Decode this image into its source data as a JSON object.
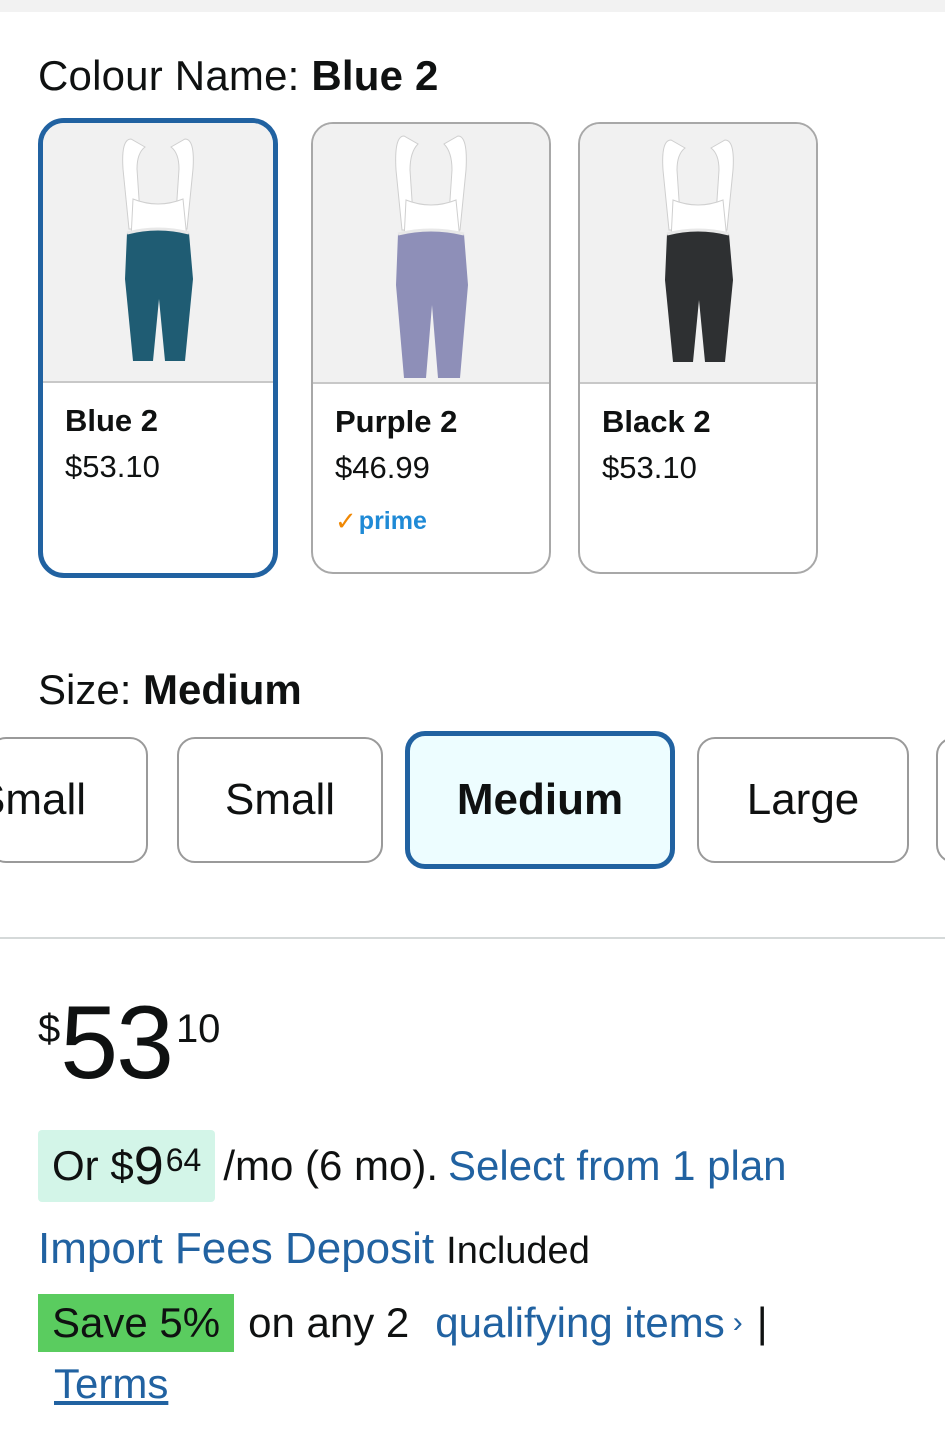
{
  "colour": {
    "label": "Colour Name: ",
    "value": "Blue 2",
    "swatches": [
      {
        "name": "Blue 2",
        "price": "$53.10",
        "color": "#1f5c73",
        "prime": ""
      },
      {
        "name": "Purple 2",
        "price": "$46.99",
        "color": "#8e8fb8",
        "prime": "prime"
      },
      {
        "name": "Black 2",
        "price": "$53.10",
        "color": "#2e3032",
        "prime": ""
      }
    ]
  },
  "size": {
    "label": "Size: ",
    "value": "Medium",
    "options": [
      "Small",
      "Small",
      "Medium",
      "Large"
    ]
  },
  "price": {
    "symbol": "$",
    "whole": "53",
    "fraction": "10"
  },
  "installment": {
    "prefix": "Or $",
    "whole": "9",
    "fraction": "64",
    "rest": "/mo (6 mo).",
    "link": "Select from 1 plan"
  },
  "fees": {
    "link": "Import Fees Deposit",
    "text": "Included"
  },
  "promo": {
    "badge": "Save 5%",
    "text": "on any 2",
    "link": "qualifying items",
    "chevron": "›",
    "separator": "|",
    "terms": "Terms"
  },
  "colors": {
    "accent": "#2162a1",
    "selected_bg": "#edfdff",
    "installment_bg": "#d3f5e8",
    "promo_bg": "#5acc5f"
  }
}
